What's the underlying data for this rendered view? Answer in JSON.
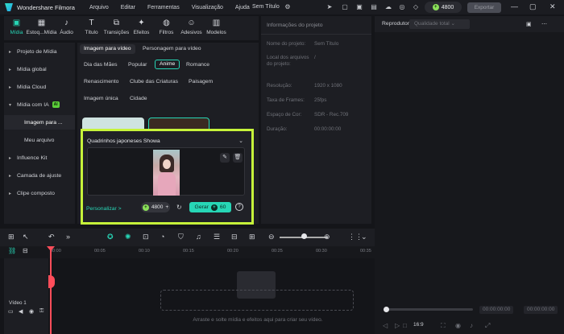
{
  "app": {
    "name": "Wondershare Filmora",
    "doc_title": "Sem Título",
    "credits": "4800",
    "export_label": "Exportar"
  },
  "menu": [
    "Arquivo",
    "Editar",
    "Ferramentas",
    "Visualização",
    "Ajuda"
  ],
  "tools": [
    {
      "label": "Mídia",
      "icon": "media-icon"
    },
    {
      "label": "Estoq...Mídia",
      "icon": "stock-media-icon"
    },
    {
      "label": "Áudio",
      "icon": "audio-icon"
    },
    {
      "label": "Título",
      "icon": "title-icon"
    },
    {
      "label": "Transições",
      "icon": "transitions-icon"
    },
    {
      "label": "Efeitos",
      "icon": "effects-icon"
    },
    {
      "label": "Filtros",
      "icon": "filters-icon"
    },
    {
      "label": "Adesivos",
      "icon": "stickers-icon"
    },
    {
      "label": "Modelos",
      "icon": "templates-icon"
    }
  ],
  "sidebar": {
    "items": [
      "Projeto de Mídia",
      "Mídia global",
      "Mídia Cloud",
      "Mídia com IA",
      "Influence Kit",
      "Camada de ajuste",
      "Clipe composto"
    ],
    "ai_badge": "AI",
    "sub_items": [
      "Imagem para ...",
      "Meu arquivo"
    ]
  },
  "content": {
    "tabs": [
      "Imagem para vídeo",
      "Personagem para vídeo"
    ],
    "categories": [
      "Dia das Mães",
      "Popular",
      "Anime",
      "Romance",
      "Renascimento",
      "Clube das Criaturas",
      "Paisagem",
      "Imagem única",
      "Cidade"
    ]
  },
  "popup": {
    "title": "Quadrinhos japoneses Showa",
    "customize": "Personalizar >",
    "credits": "4800",
    "generate_label": "Gerar",
    "generate_cost": "60"
  },
  "info": {
    "title": "Informações do projeto",
    "rows": [
      {
        "label": "Nome do projeto:",
        "value": "Sem Título"
      },
      {
        "label": "Local dos arquivos do projeto:",
        "value": "/"
      },
      {
        "label": "Resolução:",
        "value": "1920 x 1080"
      },
      {
        "label": "Taxa de Frames:",
        "value": "25fps"
      },
      {
        "label": "Espaço de Cor:",
        "value": "SDR - Rec.709"
      },
      {
        "label": "Duração:",
        "value": "00:00:00:00"
      }
    ]
  },
  "player": {
    "label": "Reprodutor",
    "quality": "Qualidade total",
    "time_current": "00:00:00:00",
    "time_total": "00:00:00:00",
    "ratio": "16:9"
  },
  "timeline": {
    "ticks": [
      "00:00",
      "00:05",
      "00:10",
      "00:15",
      "00:20",
      "00:25",
      "00:30",
      "00:35"
    ],
    "track_label": "Vídeo 1",
    "drop_message": "Arraste e solte mídia e efeitos aqui para criar seu vídeo."
  },
  "colors": {
    "accent": "#27d6b6",
    "highlight": "#c6f33a",
    "playhead": "#ff4d5a"
  }
}
